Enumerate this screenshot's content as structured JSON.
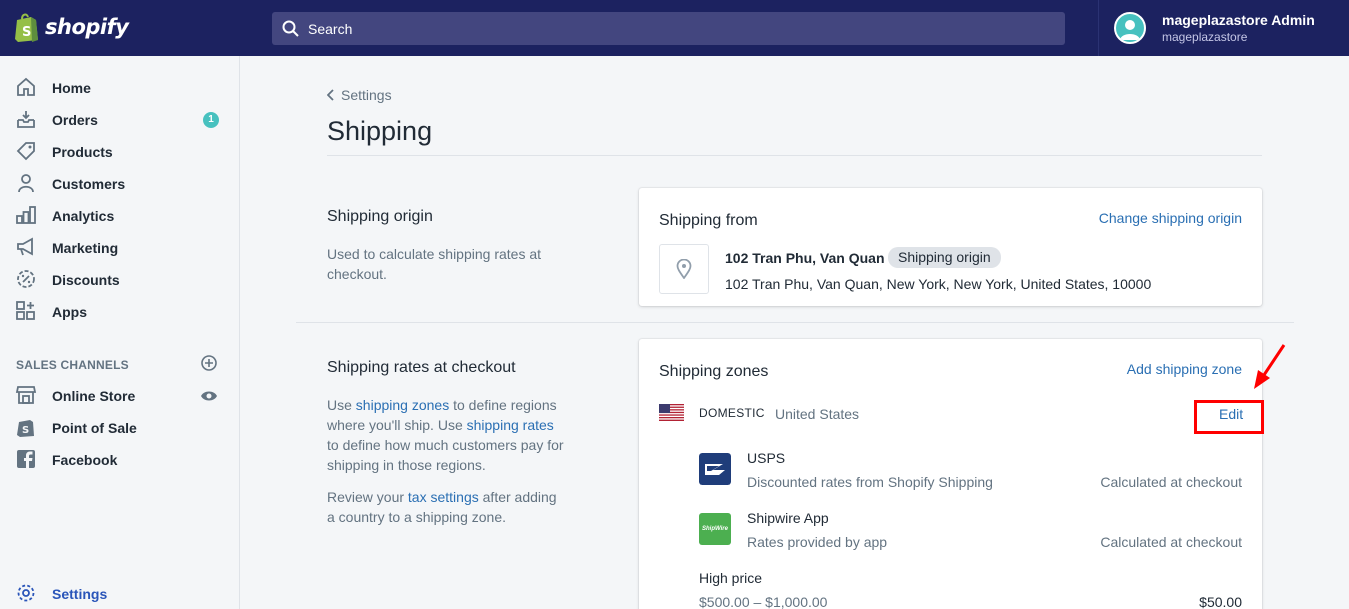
{
  "app": {
    "brand": "shopify"
  },
  "search": {
    "placeholder": "Search"
  },
  "user": {
    "name": "mageplazastore Admin",
    "store": "mageplazastore"
  },
  "sidebar": {
    "items": [
      {
        "label": "Home",
        "icon": "home-icon"
      },
      {
        "label": "Orders",
        "icon": "orders-icon",
        "badge": "1"
      },
      {
        "label": "Products",
        "icon": "tag-icon"
      },
      {
        "label": "Customers",
        "icon": "person-icon"
      },
      {
        "label": "Analytics",
        "icon": "bar-chart-icon"
      },
      {
        "label": "Marketing",
        "icon": "megaphone-icon"
      },
      {
        "label": "Discounts",
        "icon": "discount-icon"
      },
      {
        "label": "Apps",
        "icon": "apps-icon"
      }
    ],
    "channels_heading": "SALES CHANNELS",
    "channels": [
      {
        "label": "Online Store",
        "icon": "store-icon"
      },
      {
        "label": "Point of Sale",
        "icon": "shopify-bag-icon"
      },
      {
        "label": "Facebook",
        "icon": "facebook-icon"
      }
    ],
    "settings_label": "Settings"
  },
  "page": {
    "breadcrumb": "Settings",
    "title": "Shipping"
  },
  "origin_section": {
    "title": "Shipping origin",
    "description": "Used to calculate shipping rates at checkout.",
    "card": {
      "title": "Shipping from",
      "action": "Change shipping origin",
      "address_name": "102 Tran Phu, Van Quan",
      "badge": "Shipping origin",
      "address_full": "102 Tran Phu, Van Quan, New York, New York, United States, 10000"
    }
  },
  "rates_section": {
    "title": "Shipping rates at checkout",
    "desc_p1_a": "Use ",
    "desc_p1_link1": "shipping zones",
    "desc_p1_b": " to define regions where you'll ship. Use ",
    "desc_p1_link2": "shipping rates",
    "desc_p1_c": " to define how much customers pay for shipping in those regions.",
    "desc_p2_a": "Review your ",
    "desc_p2_link": "tax settings",
    "desc_p2_b": " after adding a country to a shipping zone.",
    "card": {
      "title": "Shipping zones",
      "action": "Add shipping zone",
      "zone_name": "DOMESTIC",
      "zone_country": "United States",
      "edit": "Edit",
      "rates": [
        {
          "name": "USPS",
          "desc": "Discounted rates from Shopify Shipping",
          "value": "Calculated at checkout",
          "logo": "usps-logo"
        },
        {
          "name": "Shipwire App",
          "desc": "Rates provided by app",
          "value": "Calculated at checkout",
          "logo": "shipwire-logo",
          "logo_text": "ShipWire"
        }
      ],
      "price_rate": {
        "name": "High price",
        "range": "$500.00 – $1,000.00",
        "value": "$50.00"
      }
    }
  },
  "colors": {
    "topbar": "#1c2260",
    "accent": "#2a6fb3",
    "highlight": "#ff0000",
    "badge": "#47c1bf"
  }
}
